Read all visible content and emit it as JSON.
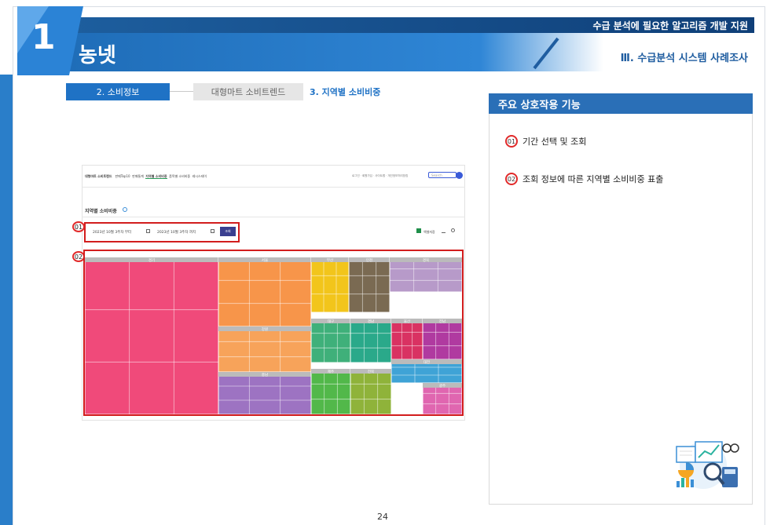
{
  "header": {
    "top_banner": "수급 분석에 필요한 알고리즘 개발 지원",
    "section_number": "1",
    "title": "농넷",
    "subtitle": "Ⅲ. 수급분석 시스템 사례조사"
  },
  "tabs": [
    {
      "label": "2. 소비정보",
      "active": true
    },
    {
      "label": "대형마트 소비트렌드",
      "active": false
    },
    {
      "label": "3. 지역별 소비비중",
      "active": true
    }
  ],
  "panel": {
    "title": "주요 상호작용 기능",
    "features": [
      {
        "num": "01",
        "label": "기간 선택 및 조회"
      },
      {
        "num": "02",
        "label": "조회 정보에 따른 지역별 소비비중 표출"
      }
    ]
  },
  "screenshot": {
    "brand": "대형마트 소비트렌드",
    "nav": [
      "판매Top10",
      "판매통계",
      "지역별 소비비중",
      "품목별 소비비중",
      "레시스테이"
    ],
    "top_right": "로그인 · 회원가입 · 사이트맵 · 개인정보처리방침",
    "search_placeholder": "Search",
    "section_title": "지역별 소비비중",
    "date_from": "2023년 10월 3주차 부터",
    "date_to": "2023년 10월 3주차 까지",
    "query_button": "조회",
    "excel_label": "엑셀저장",
    "annotations": [
      "01",
      "02"
    ],
    "regions": [
      "경기",
      "서울",
      "부산",
      "인천",
      "경북",
      "대구",
      "경남",
      "울산",
      "전남",
      "대전",
      "광주",
      "강원",
      "충남",
      "제주",
      "전북"
    ]
  },
  "colors": {
    "accent": "#1f72c5",
    "annotation_red": "#e12a2a"
  },
  "page_number": "24"
}
